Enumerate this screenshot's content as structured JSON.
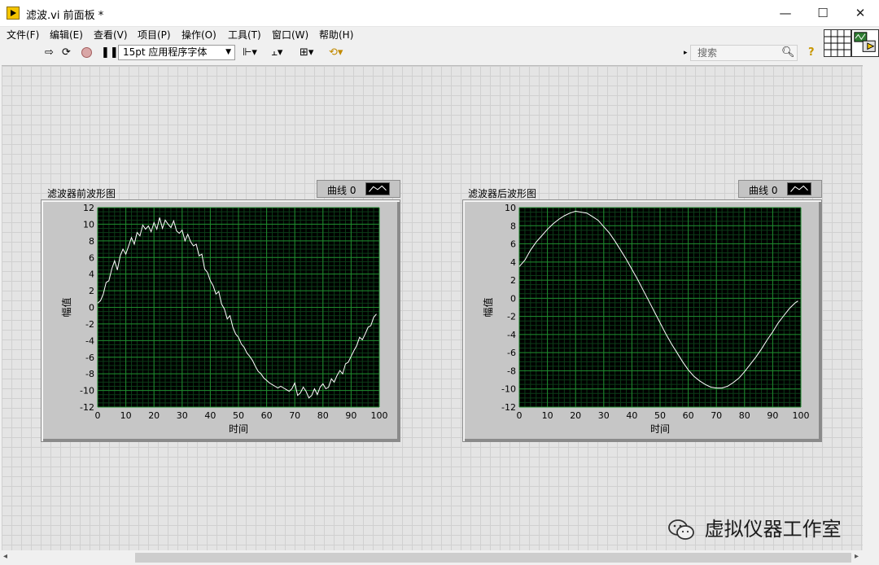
{
  "window": {
    "title": "滤波.vi 前面板 *",
    "minimize": "—",
    "maximize": "☐",
    "close": "✕"
  },
  "menu": [
    "文件(F)",
    "编辑(E)",
    "查看(V)",
    "项目(P)",
    "操作(O)",
    "工具(T)",
    "窗口(W)",
    "帮助(H)"
  ],
  "toolbar": {
    "font": "15pt 应用程序字体",
    "search_placeholder": "搜索",
    "help": "?"
  },
  "graphs": [
    {
      "label": "滤波器前波形图",
      "legend": "曲线 0",
      "chart_data": {
        "type": "line",
        "title": "",
        "xlabel": "时间",
        "ylabel": "幅值",
        "xlim": [
          0,
          100
        ],
        "ylim": [
          -12,
          12
        ],
        "xticks": [
          0,
          10,
          20,
          30,
          40,
          50,
          60,
          70,
          80,
          90,
          100
        ],
        "yticks": [
          12,
          10,
          8,
          6,
          4,
          2,
          0,
          -2,
          -4,
          -6,
          -8,
          -10,
          -12
        ],
        "grid": true,
        "series": [
          {
            "name": "曲线 0",
            "color": "#ffffff",
            "x": [
              0,
              1,
              2,
              3,
              4,
              5,
              6,
              7,
              8,
              9,
              10,
              11,
              12,
              13,
              14,
              15,
              16,
              17,
              18,
              19,
              20,
              21,
              22,
              23,
              24,
              25,
              26,
              27,
              28,
              29,
              30,
              31,
              32,
              33,
              34,
              35,
              36,
              37,
              38,
              39,
              40,
              41,
              42,
              43,
              44,
              45,
              46,
              47,
              48,
              49,
              50,
              51,
              52,
              53,
              54,
              55,
              56,
              57,
              58,
              59,
              60,
              61,
              62,
              63,
              64,
              65,
              66,
              67,
              68,
              69,
              70,
              71,
              72,
              73,
              74,
              75,
              76,
              77,
              78,
              79,
              80,
              81,
              82,
              83,
              84,
              85,
              86,
              87,
              88,
              89,
              90,
              91,
              92,
              93,
              94,
              95,
              96,
              97,
              98,
              99
            ],
            "y": [
              0.5,
              0.8,
              1.6,
              3.0,
              3.2,
              4.6,
              5.6,
              4.5,
              6.2,
              7.0,
              6.4,
              7.4,
              8.4,
              7.6,
              9.0,
              8.6,
              9.9,
              9.4,
              9.8,
              9.1,
              10.2,
              9.4,
              10.8,
              9.5,
              10.5,
              10.0,
              9.6,
              10.4,
              9.2,
              8.9,
              9.3,
              8.0,
              8.8,
              7.9,
              7.4,
              7.6,
              6.2,
              6.4,
              4.6,
              4.2,
              3.2,
              2.6,
              1.6,
              1.9,
              0.4,
              -0.2,
              -1.4,
              -1.0,
              -2.4,
              -3.2,
              -3.6,
              -4.4,
              -4.8,
              -5.5,
              -5.9,
              -6.4,
              -7.1,
              -7.7,
              -8.0,
              -8.5,
              -8.8,
              -9.1,
              -9.3,
              -9.5,
              -9.7,
              -9.5,
              -9.7,
              -9.9,
              -10.1,
              -9.8,
              -9.1,
              -10.6,
              -10.3,
              -9.6,
              -10.1,
              -10.9,
              -10.6,
              -9.8,
              -10.5,
              -9.6,
              -9.2,
              -9.8,
              -9.6,
              -8.6,
              -9.0,
              -8.2,
              -7.6,
              -8.0,
              -6.8,
              -6.6,
              -5.9,
              -5.2,
              -4.6,
              -3.6,
              -3.9,
              -3.2,
              -2.4,
              -2.2,
              -1.2,
              -0.8
            ]
          }
        ]
      }
    },
    {
      "label": "滤波器后波形图",
      "legend": "曲线 0",
      "chart_data": {
        "type": "line",
        "title": "",
        "xlabel": "时间",
        "ylabel": "幅值",
        "xlim": [
          0,
          100
        ],
        "ylim": [
          -12,
          10
        ],
        "xticks": [
          0,
          10,
          20,
          30,
          40,
          50,
          60,
          70,
          80,
          90,
          100
        ],
        "yticks": [
          10,
          8,
          6,
          4,
          2,
          0,
          -2,
          -4,
          -6,
          -8,
          -10,
          -12
        ],
        "grid": true,
        "series": [
          {
            "name": "曲线 0",
            "color": "#ffffff",
            "x": [
              0,
              2,
              4,
              6,
              8,
              10,
              12,
              14,
              16,
              18,
              20,
              22,
              24,
              26,
              28,
              30,
              32,
              34,
              36,
              38,
              40,
              42,
              44,
              46,
              48,
              50,
              52,
              54,
              56,
              58,
              60,
              62,
              64,
              66,
              68,
              70,
              72,
              74,
              76,
              78,
              80,
              82,
              84,
              86,
              88,
              90,
              92,
              94,
              96,
              98,
              99
            ],
            "y": [
              3.5,
              4.2,
              5.3,
              6.2,
              6.9,
              7.6,
              8.2,
              8.7,
              9.1,
              9.4,
              9.6,
              9.5,
              9.4,
              9.0,
              8.6,
              7.9,
              7.2,
              6.3,
              5.3,
              4.3,
              3.2,
              2.1,
              0.9,
              -0.3,
              -1.5,
              -2.7,
              -3.9,
              -5.0,
              -6.0,
              -7.0,
              -7.9,
              -8.6,
              -9.1,
              -9.5,
              -9.8,
              -9.9,
              -9.9,
              -9.7,
              -9.3,
              -8.8,
              -8.1,
              -7.3,
              -6.5,
              -5.6,
              -4.6,
              -3.7,
              -2.7,
              -1.9,
              -1.1,
              -0.5,
              -0.3
            ]
          }
        ]
      }
    }
  ],
  "watermark": "虚拟仪器工作室"
}
